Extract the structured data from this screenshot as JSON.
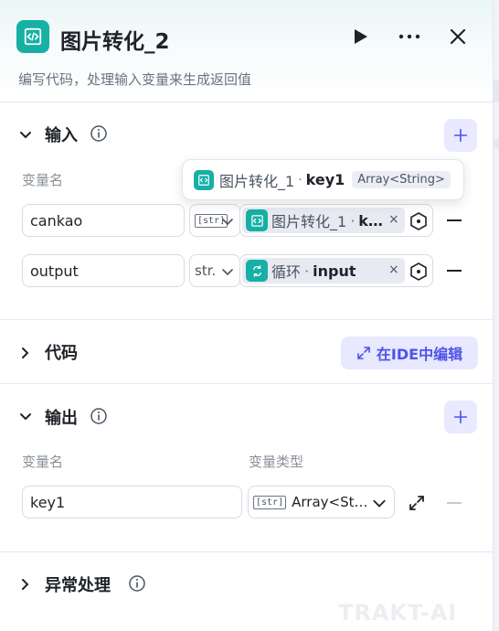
{
  "header": {
    "title": "图片转化_2",
    "subtitle": "编写代码，处理输入变量来生成返回值",
    "icons": [
      "code-icon",
      "play-icon",
      "more-icon",
      "close-icon"
    ]
  },
  "input_section": {
    "title": "输入",
    "col_name": "变量名",
    "rows": [
      {
        "name": "cankao",
        "type_badge": "[str]",
        "ref_node": "图片转化_1",
        "ref_sep": "·",
        "ref_var": "k…",
        "ref_icon": "code-icon"
      },
      {
        "name": "output",
        "type_text": "str.",
        "ref_node": "循环",
        "ref_sep": "·",
        "ref_var": "input",
        "ref_icon": "loop-icon"
      }
    ],
    "remove_symbol": "×"
  },
  "tooltip": {
    "node": "图片转化_1",
    "sep": "·",
    "var": "key1",
    "type": "Array<String>"
  },
  "code_section": {
    "title": "代码",
    "ide_button": "在IDE中编辑"
  },
  "output_section": {
    "title": "输出",
    "col_name": "变量名",
    "col_type": "变量类型",
    "rows": [
      {
        "name": "key1",
        "type_badge": "[str]",
        "type_text": "Array<St…"
      }
    ]
  },
  "error_section": {
    "title": "异常处理"
  },
  "watermark": "TRAKT-AI",
  "colors": {
    "accent": "#4d53e8",
    "node_icon": "#16b0a5",
    "chip_bg": "#e8eaf1",
    "accent_bg": "#e9e9ff"
  }
}
